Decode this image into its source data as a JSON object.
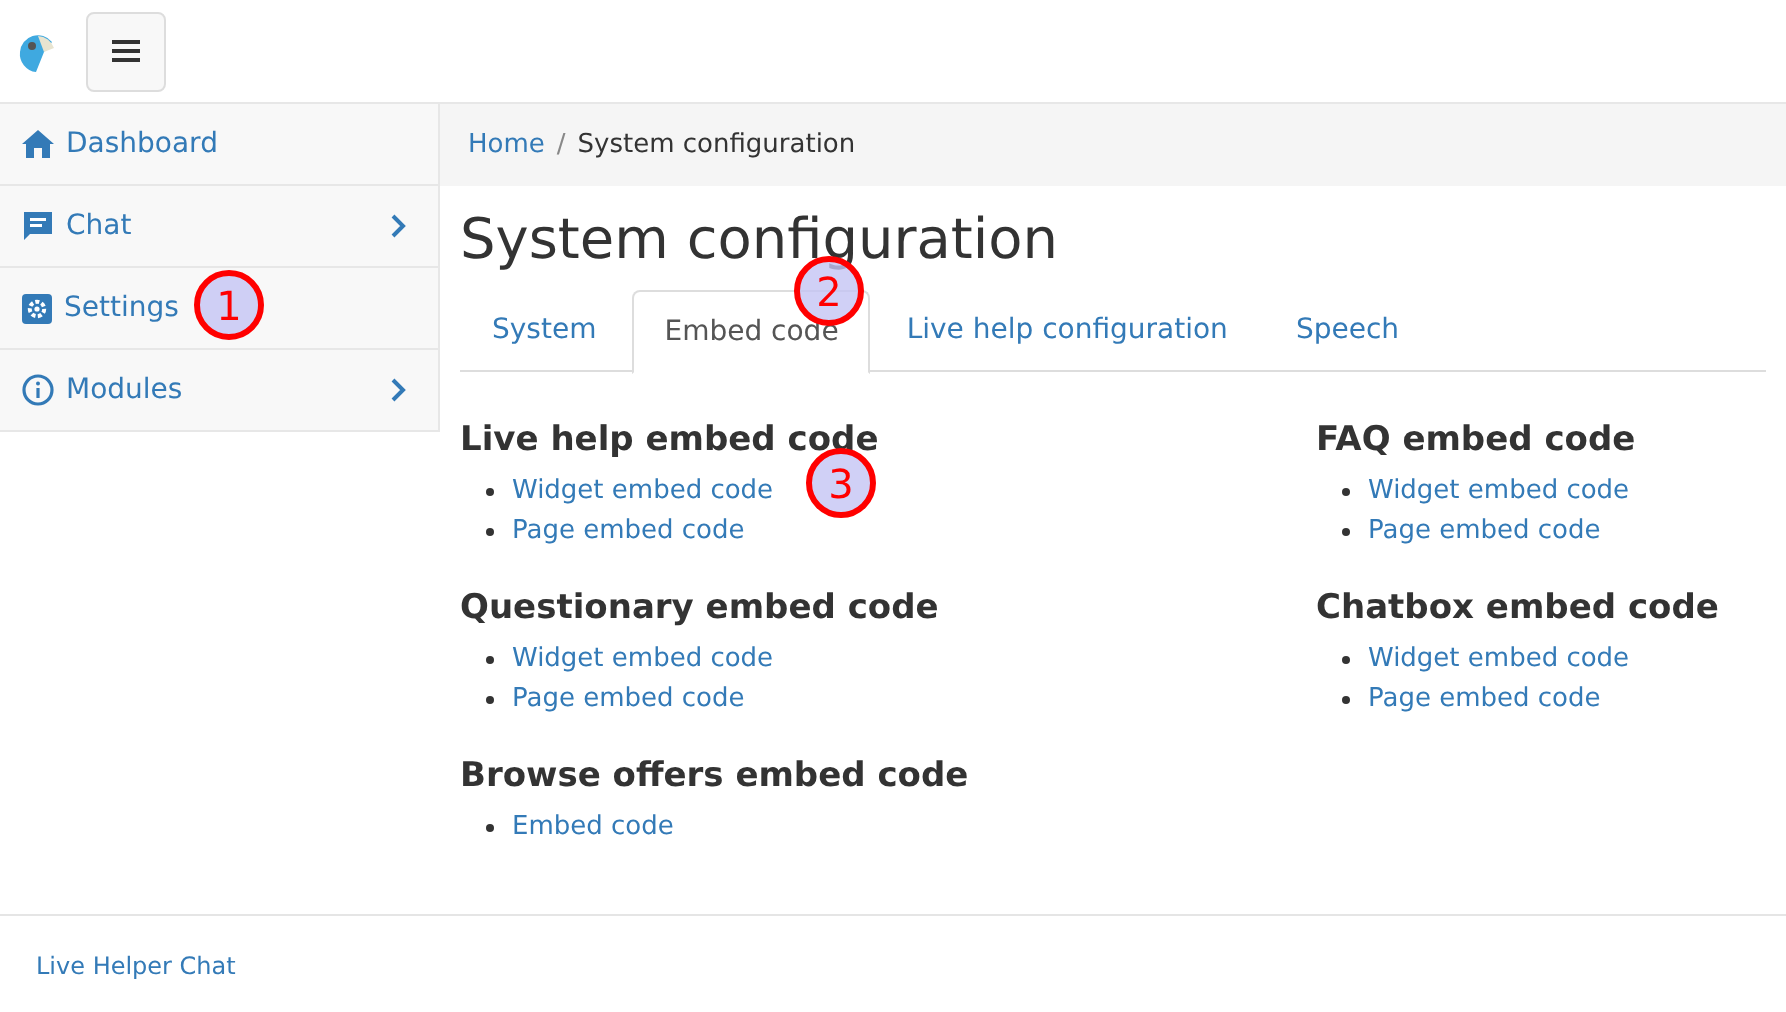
{
  "sidebar": {
    "items": [
      {
        "label": "Dashboard",
        "kind": "home",
        "expandable": false
      },
      {
        "label": "Chat",
        "kind": "chat",
        "expandable": true
      },
      {
        "label": "Settings",
        "kind": "settings",
        "expandable": false
      },
      {
        "label": "Modules",
        "kind": "info",
        "expandable": true
      }
    ]
  },
  "breadcrumb": {
    "items": [
      "Home",
      "System configuration"
    ],
    "separator": "/"
  },
  "title": "System configuration",
  "tabs": [
    {
      "label": "System",
      "selected": false
    },
    {
      "label": "Embed code",
      "selected": true
    },
    {
      "label": "Live help configuration",
      "selected": false
    },
    {
      "label": "Speech",
      "selected": false
    }
  ],
  "columns": [
    [
      {
        "heading": "Live help embed code",
        "links": [
          "Widget embed code",
          "Page embed code"
        ]
      },
      {
        "heading": "Questionary embed code",
        "links": [
          "Widget embed code",
          "Page embed code"
        ]
      },
      {
        "heading": "Browse offers embed code",
        "links": [
          "Embed code"
        ]
      }
    ],
    [
      {
        "heading": "FAQ embed code",
        "links": [
          "Widget embed code",
          "Page embed code"
        ]
      },
      {
        "heading": "Chatbox embed code",
        "links": [
          "Widget embed code",
          "Page embed code"
        ]
      }
    ]
  ],
  "footer": "Live Helper Chat",
  "callouts": [
    "1",
    "2",
    "3"
  ]
}
